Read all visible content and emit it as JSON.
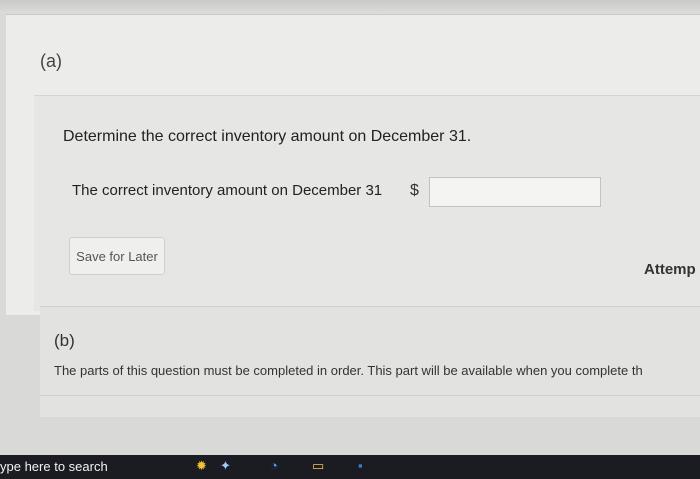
{
  "part_a": {
    "label": "(a)",
    "question": "Determine the correct inventory amount on December 31.",
    "answer_label": "The correct inventory amount on December 31",
    "currency": "$",
    "input_value": "",
    "save_label": "Save for Later",
    "attempts_label": "Attemp"
  },
  "part_b": {
    "label": "(b)",
    "note": "The parts of this question must be completed in order. This part will be available when you complete th"
  },
  "taskbar": {
    "search_text": "ype here to search",
    "icons": [
      "weather-icon",
      "edge-icon",
      "file-explorer-icon",
      "app-icon"
    ]
  }
}
